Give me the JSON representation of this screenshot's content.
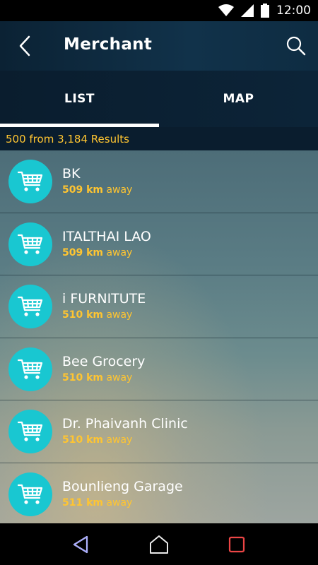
{
  "status_bar": {
    "time": "12:00"
  },
  "header": {
    "title": "Merchant",
    "back_icon": "chevron-left-icon",
    "search_icon": "search-icon"
  },
  "tabs": [
    {
      "label": "LIST",
      "active": true
    },
    {
      "label": "MAP",
      "active": false
    }
  ],
  "results_text": "500 from 3,184 Results",
  "merchants": [
    {
      "name": "BK",
      "distance": "509 km",
      "suffix": "away"
    },
    {
      "name": "ITALTHAI LAO",
      "distance": "509 km",
      "suffix": "away"
    },
    {
      "name": "i FURNITUTE",
      "distance": "510 km",
      "suffix": "away"
    },
    {
      "name": "Bee Grocery",
      "distance": "510 km",
      "suffix": "away"
    },
    {
      "name": "Dr. Phaivanh Clinic",
      "distance": "510 km",
      "suffix": "away"
    },
    {
      "name": "Bounlieng Garage",
      "distance": "511 km",
      "suffix": "away"
    }
  ],
  "colors": {
    "accent": "#ffc531",
    "avatar": "#19c7d1"
  },
  "nav": {
    "back_icon": "triangle-back-icon",
    "home_icon": "home-icon",
    "recents_icon": "square-recents-icon"
  }
}
